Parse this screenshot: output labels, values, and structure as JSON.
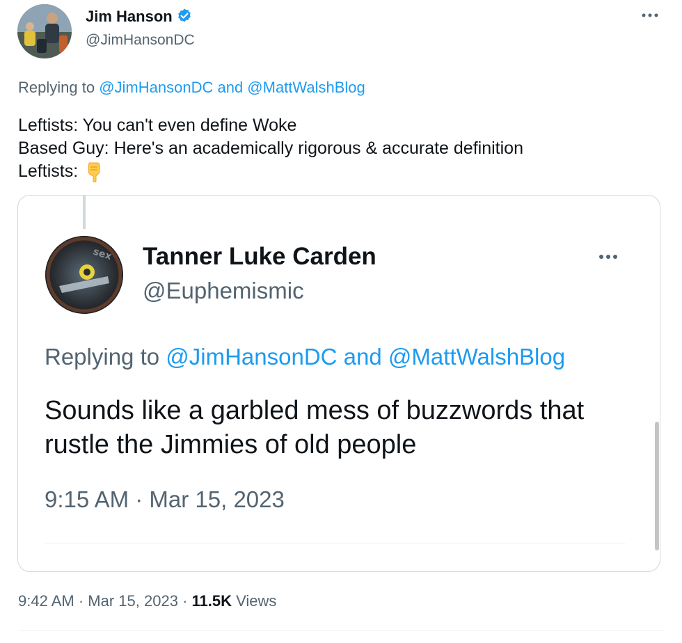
{
  "tweet": {
    "author": {
      "display_name": "Jim Hanson",
      "handle": "@JimHansonDC",
      "verified": true,
      "verified_color": "#1d9bf0"
    },
    "more_icon": "more-horizontal-icon",
    "replying_prefix": "Replying to",
    "replying_mentions": "@JimHansonDC and @MattWalshBlog",
    "text_lines": [
      "Leftists: You can't even define Woke",
      "Based Guy: Here's an academically rigorous & accurate definition",
      "Leftists:"
    ],
    "emoji": "backhand-index-pointing-down-emoji",
    "time": "9:42 AM",
    "separator": "·",
    "date": "Mar 15, 2023",
    "views_count": "11.5K",
    "views_label": "Views"
  },
  "quoted": {
    "author": {
      "display_name": "Tanner Luke Carden",
      "handle": "@Euphemismic",
      "avatar_text": "sex"
    },
    "replying_prefix": "Replying to",
    "replying_mentions": "@JimHansonDC and @MattWalshBlog",
    "text": "Sounds like a garbled mess of buzzwords that rustle the Jimmies of old people",
    "timestamp": "9:15 AM · Mar 15, 2023"
  },
  "colors": {
    "text_primary": "#0f1419",
    "text_secondary": "#536471",
    "link": "#1d9bf0",
    "border": "#cfd9de"
  }
}
